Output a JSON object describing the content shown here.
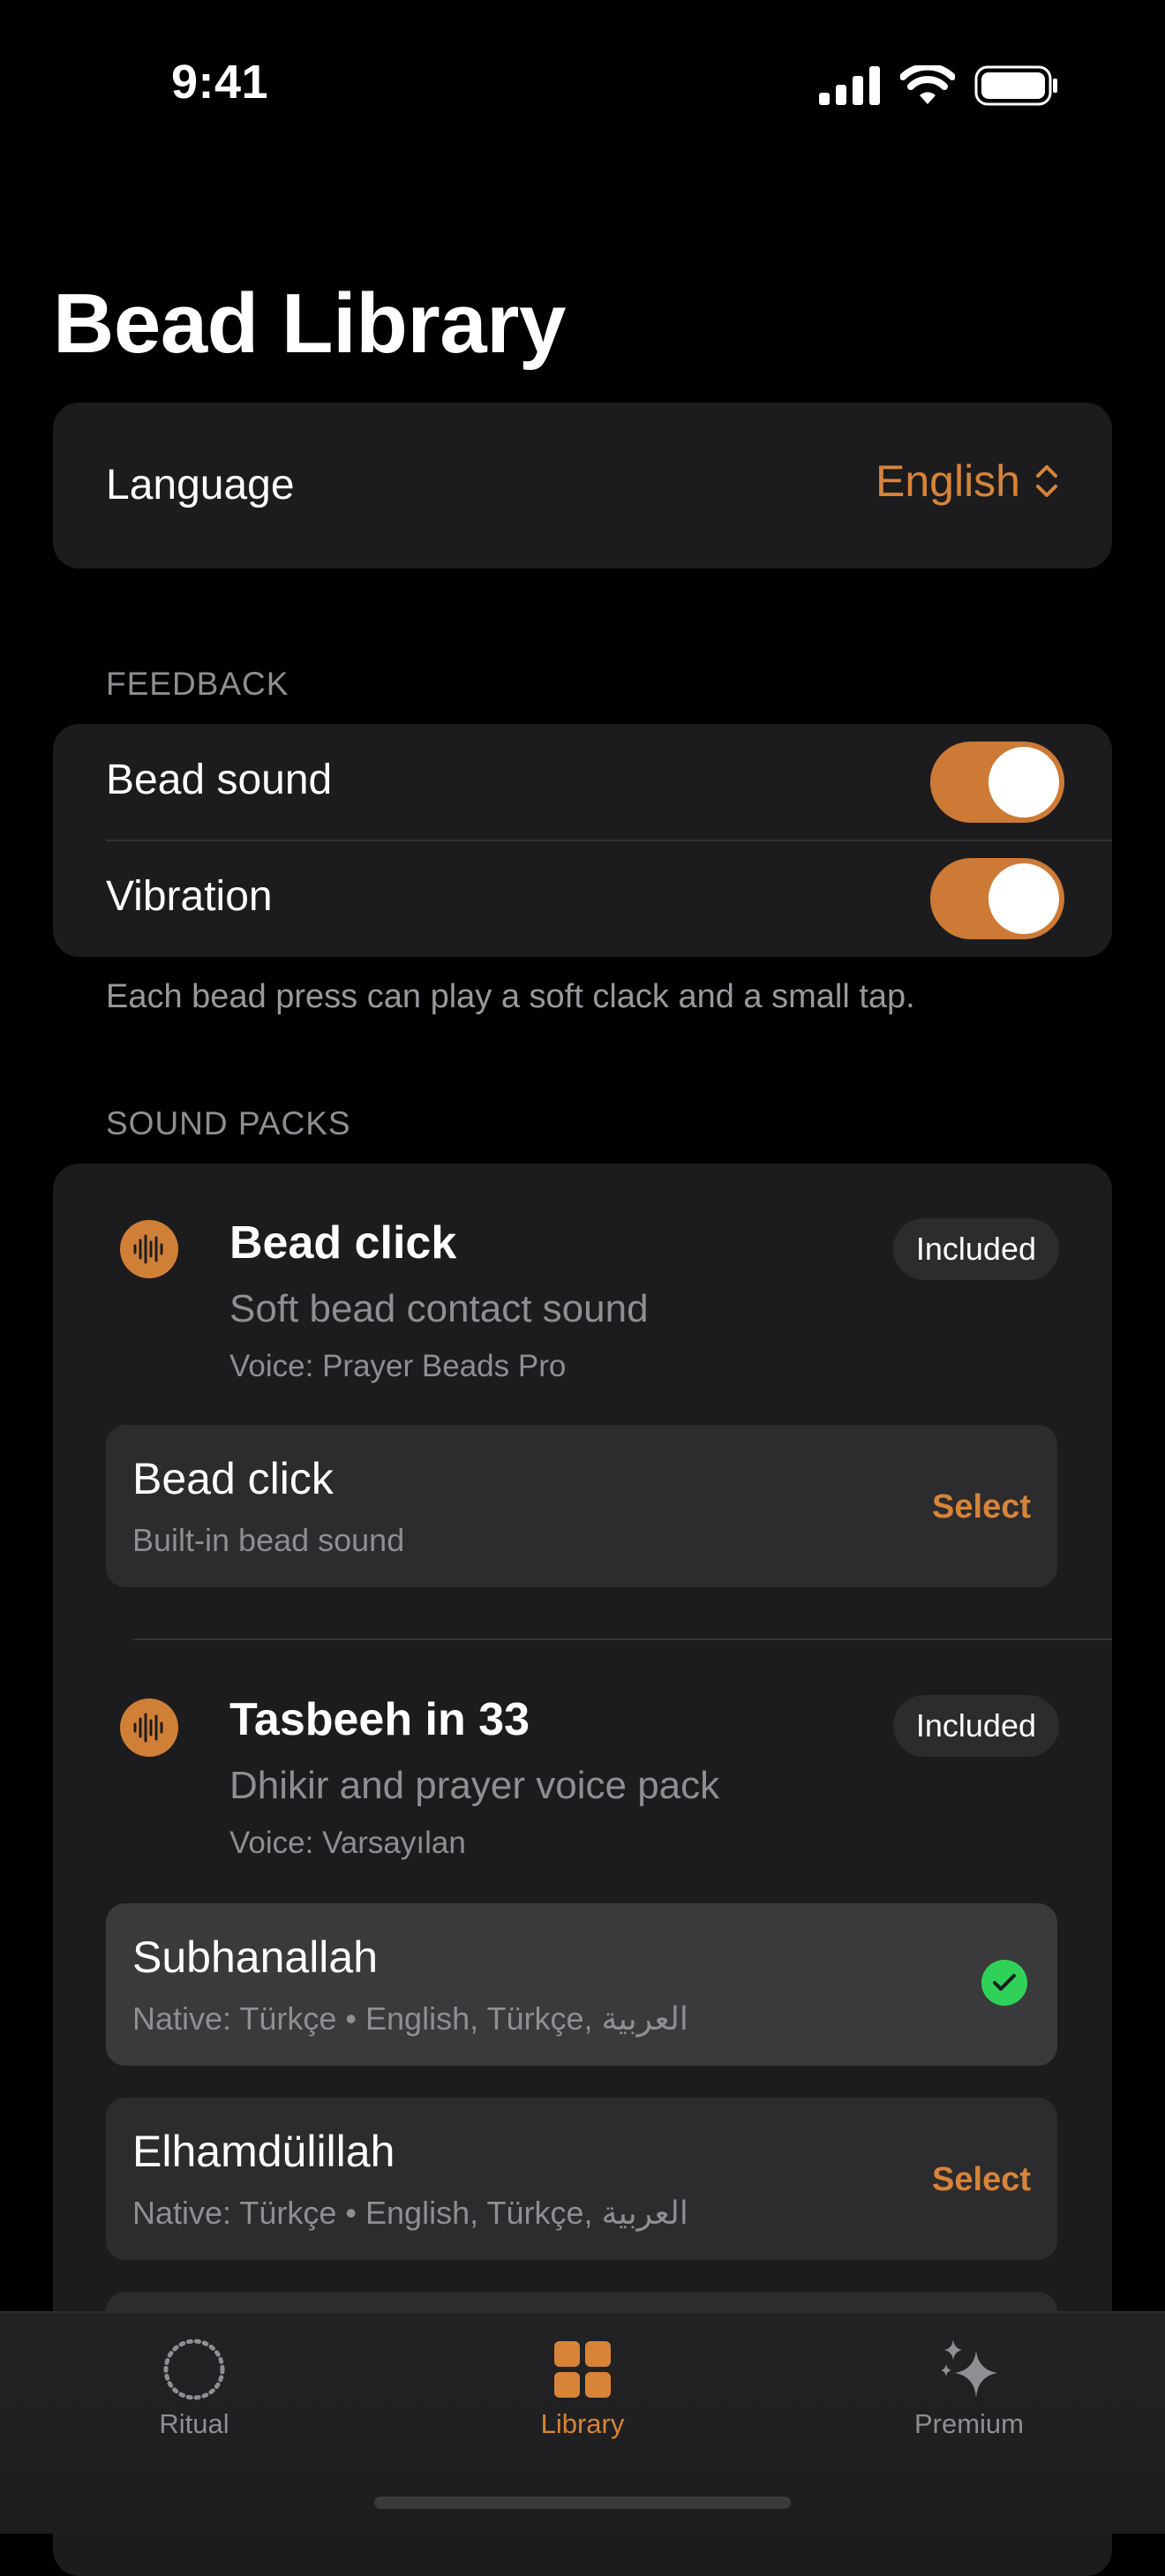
{
  "status": {
    "time": "9:41"
  },
  "page": {
    "title": "Bead Library"
  },
  "language": {
    "label": "Language",
    "value": "English"
  },
  "feedback": {
    "header": "FEEDBACK",
    "bead_sound": {
      "label": "Bead sound",
      "on": true
    },
    "vibration": {
      "label": "Vibration",
      "on": true
    },
    "footnote": "Each bead press can play a soft clack and a small tap."
  },
  "sound_packs": {
    "header": "SOUND PACKS",
    "packs": [
      {
        "title": "Bead click",
        "subtitle": "Soft bead contact sound",
        "voice": "Voice: Prayer Beads Pro",
        "badge": "Included",
        "options": [
          {
            "title": "Bead click",
            "subtitle": "Built-in bead sound",
            "action": "Select",
            "selected": false
          }
        ]
      },
      {
        "title": "Tasbeeh in 33",
        "subtitle": "Dhikir and prayer voice pack",
        "voice": "Voice: Varsayılan",
        "badge": "Included",
        "options": [
          {
            "title": "Subhanallah",
            "subtitle": "Native: Türkçe • English, Türkçe, العربية",
            "selected": true
          },
          {
            "title": "Elhamdülillah",
            "subtitle": "Native: Türkçe • English, Türkçe, العربية",
            "action": "Select",
            "selected": false
          }
        ]
      }
    ]
  },
  "tabs": [
    {
      "label": "Ritual",
      "icon": "dotted-circle-icon",
      "active": false
    },
    {
      "label": "Library",
      "icon": "grid-icon",
      "active": true
    },
    {
      "label": "Premium",
      "icon": "sparkles-icon",
      "active": false
    }
  ],
  "colors": {
    "accent": "#d78439",
    "toggle": "#cc7a35",
    "check": "#30d158",
    "card": "#1c1c1e",
    "background": "#000000"
  }
}
